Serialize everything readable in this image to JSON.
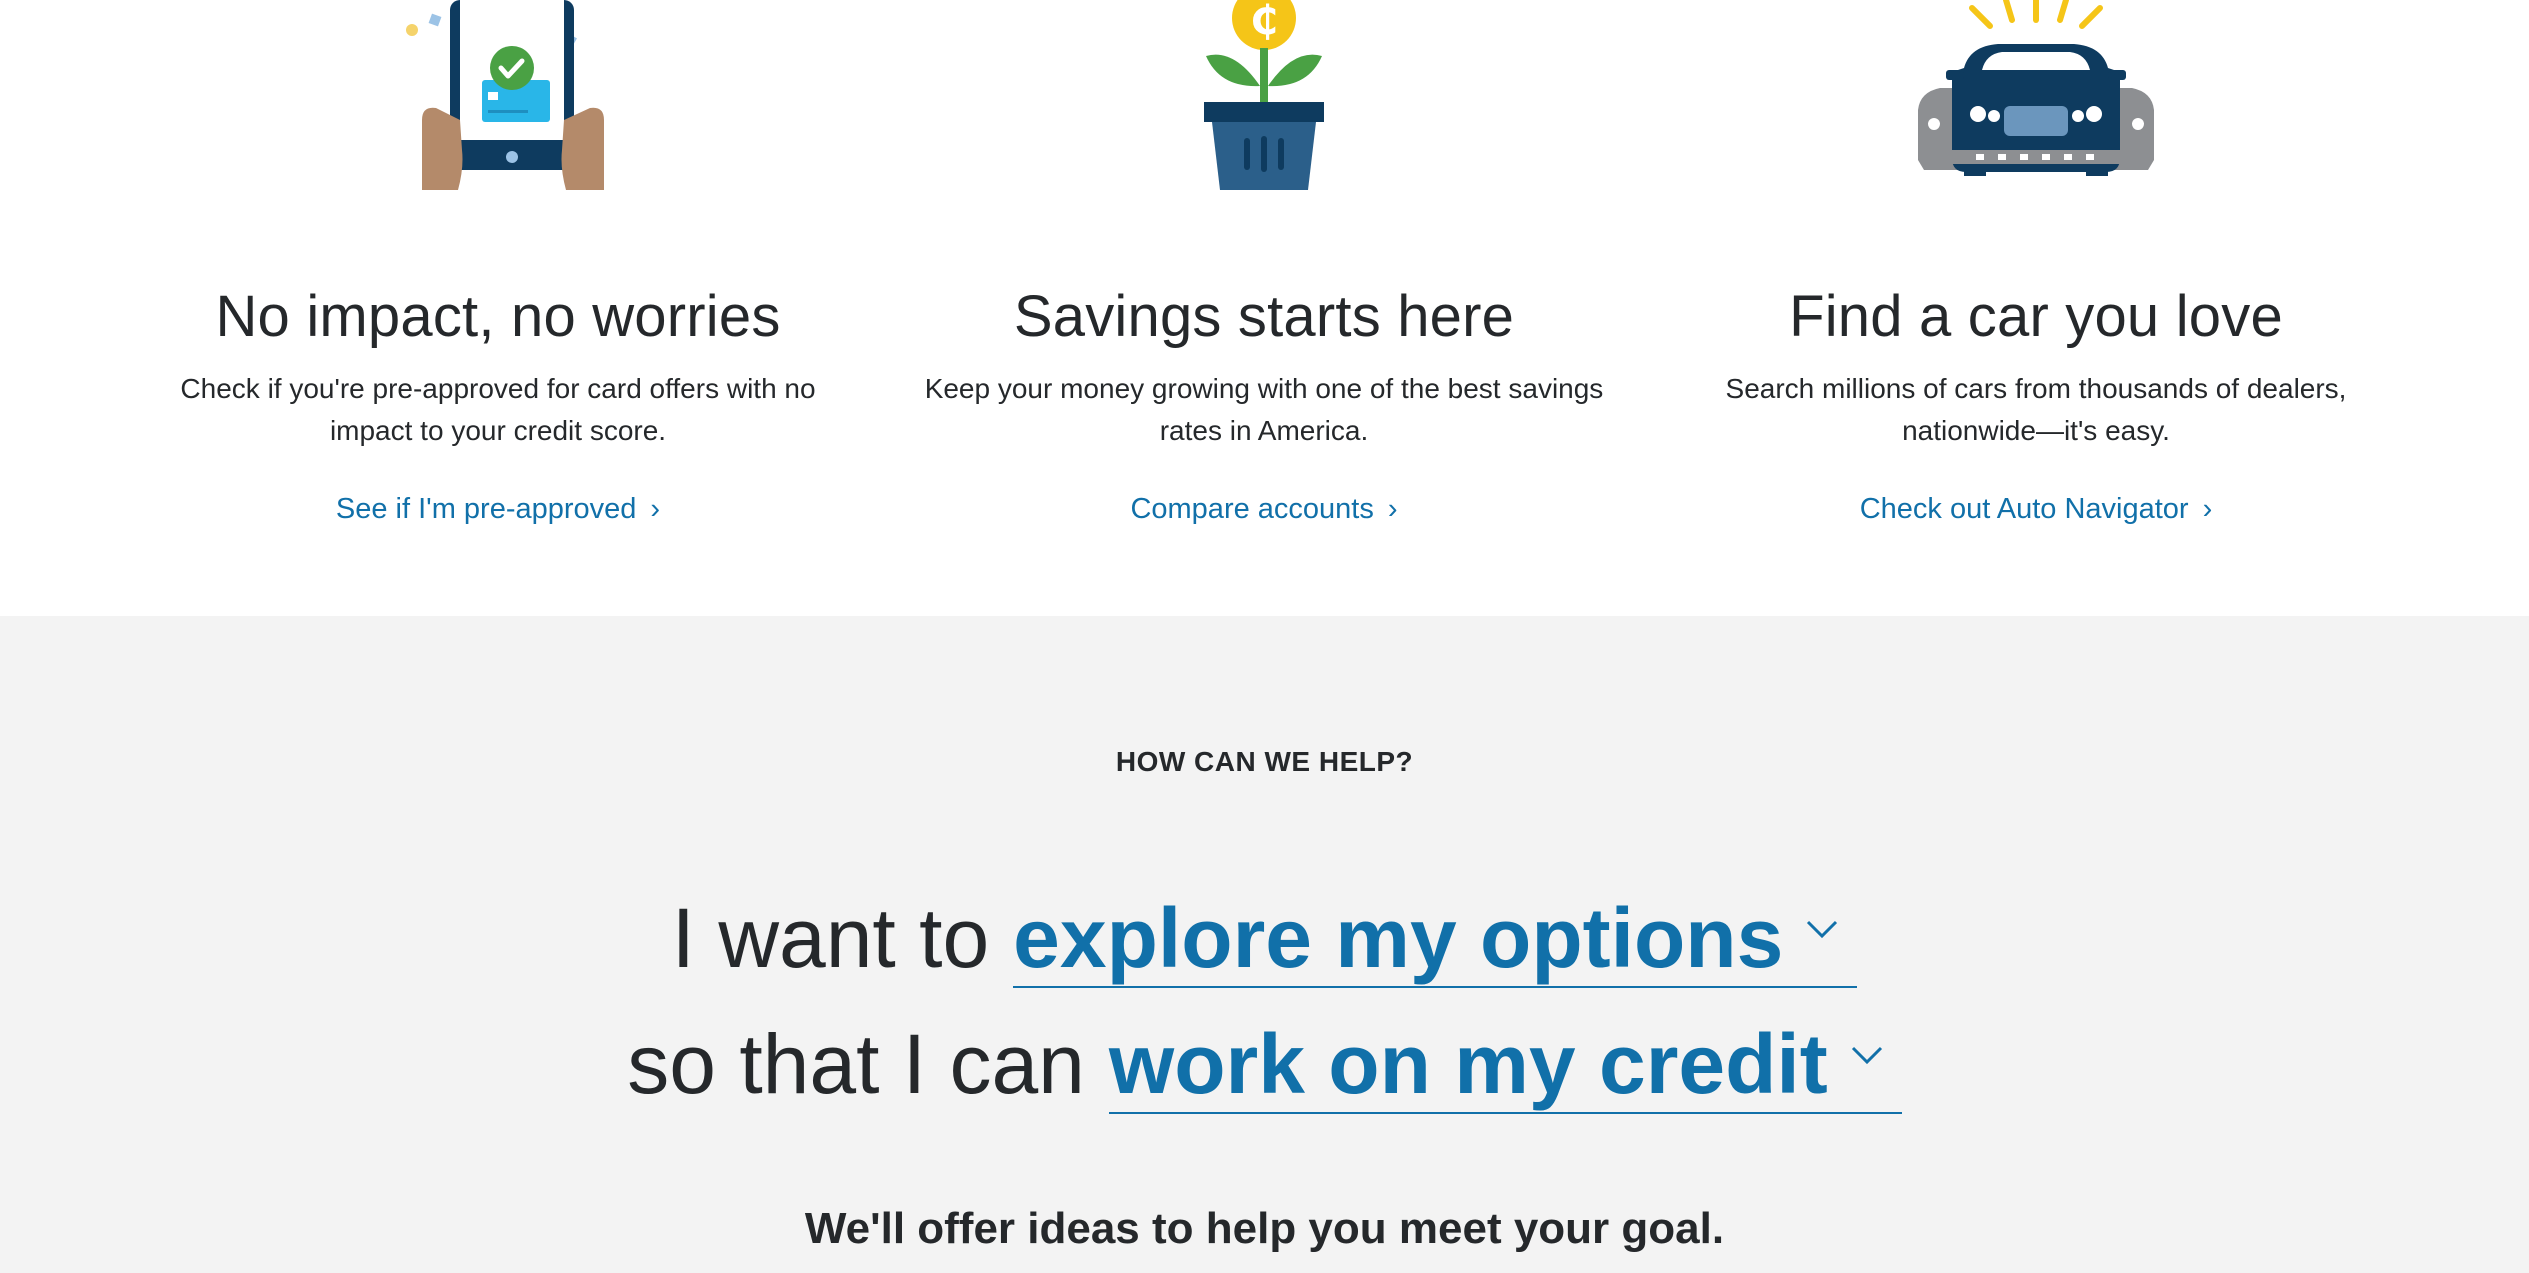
{
  "features": [
    {
      "icon": "tablet-approval-icon",
      "title": "No impact, no worries",
      "body_line1": "Check if you're pre-approved for card offers with no",
      "body_line2": "impact to your credit score.",
      "link": "See if I'm pre-approved"
    },
    {
      "icon": "plant-coin-icon",
      "title": "Savings starts here",
      "body_line1": "Keep your money growing with one of the best savings",
      "body_line2": "rates in America.",
      "link": "Compare accounts"
    },
    {
      "icon": "car-icon",
      "title": "Find a car you love",
      "body_line1": "Search millions of cars from thousands of dealers,",
      "body_line2": "nationwide—it's easy.",
      "link": "Check out Auto Navigator"
    }
  ],
  "help": {
    "eyebrow": "HOW CAN WE HELP?",
    "row1_prefix": "I want to",
    "row1_select": "explore my options",
    "row2_prefix": "so that I can",
    "row2_select": "work on my credit",
    "goal_text": "We'll offer ideas to help you meet your goal."
  },
  "colors": {
    "link": "#1170a9",
    "text": "#25282b",
    "help_bg": "#f3f3f3",
    "navy": "#0e3b5f",
    "coin": "#f5c518",
    "leaf": "#4aa144",
    "approve": "#4aa144"
  }
}
